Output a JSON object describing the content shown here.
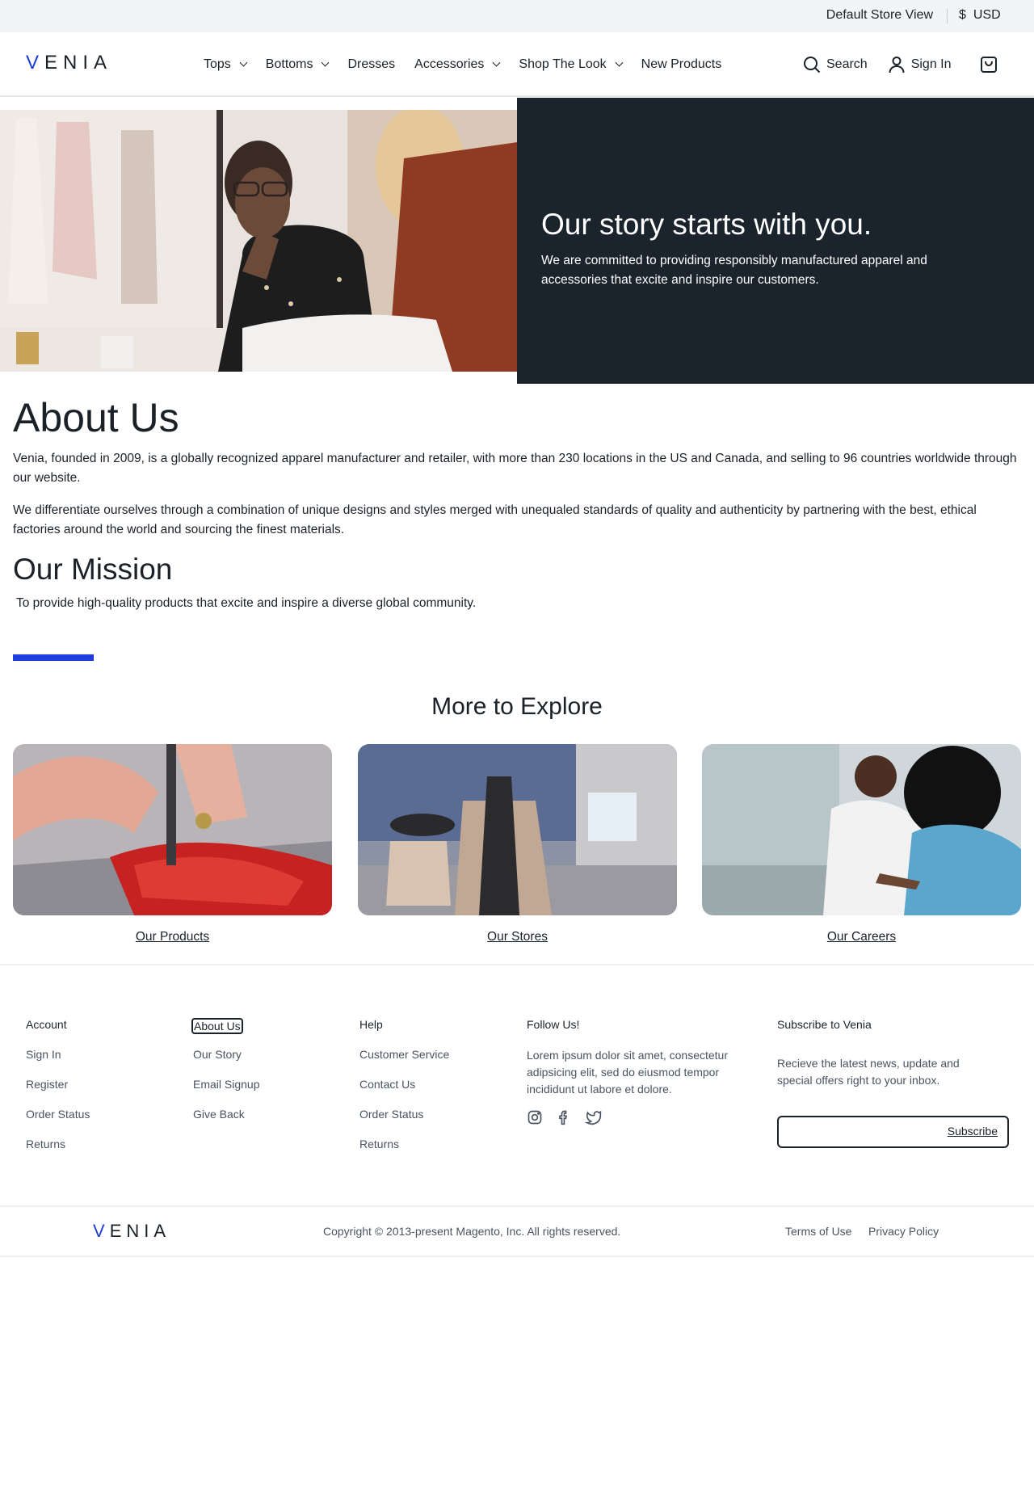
{
  "utility_bar": {
    "store_view": "Default Store View",
    "currency_symbol": "$",
    "currency": "USD"
  },
  "header": {
    "logo_v": "V",
    "logo_rest": "ENIA",
    "nav": [
      {
        "label": "Tops"
      },
      {
        "label": "Bottoms"
      },
      {
        "label": "Dresses"
      },
      {
        "label": "Accessories"
      },
      {
        "label": "Shop The Look"
      },
      {
        "label": "New Products"
      }
    ],
    "search_label": "Search",
    "signin_label": "Sign In",
    "icons": {
      "search": "search-icon",
      "account": "user-icon",
      "cart": "shopping-bag-icon"
    }
  },
  "hero": {
    "title": "Our story starts with you.",
    "text": "We are committed to providing responsibly manufactured apparel and accessories that excite and inspire our customers."
  },
  "about": {
    "title": "About Us",
    "para1": "Venia, founded in 2009, is a globally recognized apparel manufacturer and retailer, with more than 230 locations in the US and Canada, and selling to 96 countries worldwide through our website.",
    "para2": "We differentiate ourselves through a combination of unique designs and styles merged with unequaled standards of quality and authenticity by partnering with the best, ethical factories around the world and sourcing the finest materials."
  },
  "mission": {
    "title": "Our Mission",
    "text": "To provide high-quality products that excite and inspire a diverse global community."
  },
  "explore": {
    "title": "More to Explore",
    "cards": [
      {
        "label": "Our Products"
      },
      {
        "label": "Our Stores"
      },
      {
        "label": "Our Careers"
      }
    ]
  },
  "footer": {
    "account": {
      "heading": "Account",
      "links": [
        "Sign In",
        "Register",
        "Order Status",
        "Returns"
      ]
    },
    "about": {
      "heading": "About Us",
      "links": [
        "Our Story",
        "Email Signup",
        "Give Back"
      ]
    },
    "help": {
      "heading": "Help",
      "links": [
        "Customer Service",
        "Contact Us",
        "Order Status",
        "Returns"
      ]
    },
    "follow": {
      "heading": "Follow Us!",
      "text": "Lorem ipsum dolor sit amet, consectetur adipsicing elit, sed do eiusmod tempor incididunt ut labore et dolore.",
      "icons": [
        "instagram-icon",
        "facebook-icon",
        "twitter-icon"
      ]
    },
    "subscribe": {
      "heading": "Subscribe to Venia",
      "text": "Recieve the latest news, update and special offers right to your inbox.",
      "input_value": "",
      "button": "Subscribe"
    },
    "bottom": {
      "logo_v": "V",
      "logo_rest": "ENIA",
      "copyright": "Copyright © 2013-present Magento, Inc. All rights reserved.",
      "terms": "Terms of Use",
      "privacy": "Privacy Policy"
    }
  },
  "colors": {
    "accent": "#1f3ddb",
    "hero_panel": "#1b242c",
    "text": "#1b2128",
    "muted": "#4a5360"
  }
}
